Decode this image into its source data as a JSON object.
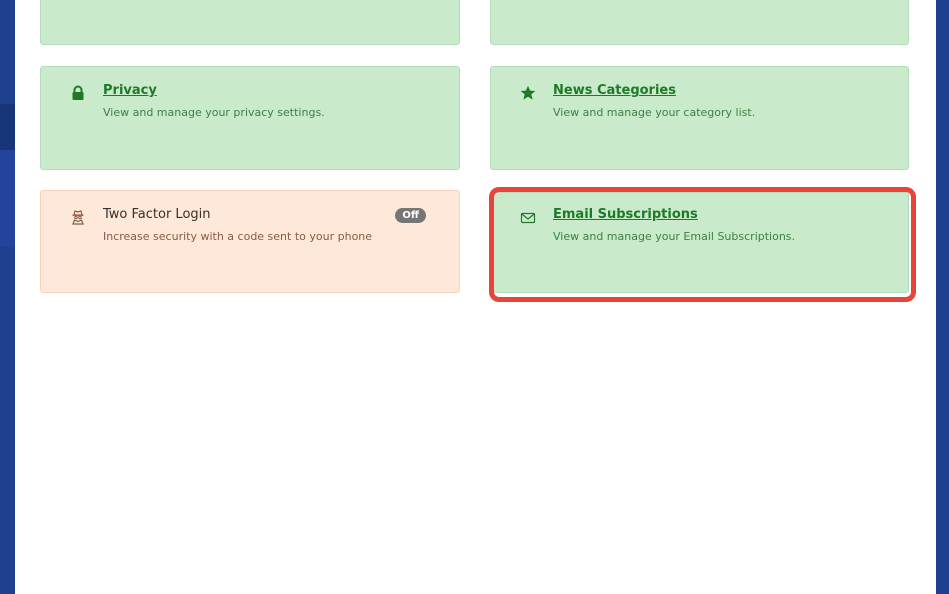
{
  "cards": {
    "privacy": {
      "title": "Privacy",
      "description": "View and manage your privacy settings.",
      "icon": "lock-icon"
    },
    "news_categories": {
      "title": "News Categories",
      "description": "View and manage your category list.",
      "icon": "star-icon"
    },
    "two_factor": {
      "title": "Two Factor Login",
      "description": "Increase security with a code sent to your phone",
      "status": "Off",
      "icon": "user-secret-icon"
    },
    "email_subscriptions": {
      "title": "Email Subscriptions",
      "description": "View and manage your Email Subscriptions.",
      "icon": "envelope-icon"
    }
  },
  "colors": {
    "card_green": "#c9ebcc",
    "card_peach": "#fde8da",
    "link_green": "#1f7a28",
    "highlight": "#e8443a",
    "side_blue": "#1f3f8f"
  }
}
